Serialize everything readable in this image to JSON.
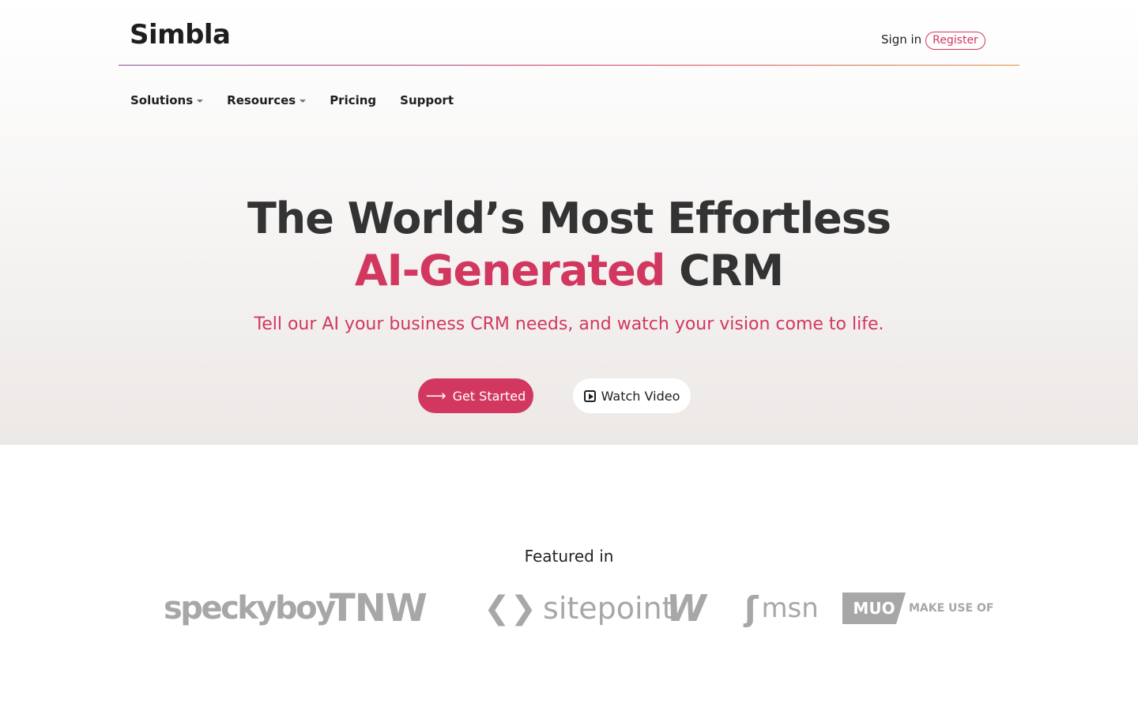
{
  "header": {
    "logo": "Simbla",
    "sign_in": "Sign in",
    "register": "Register"
  },
  "nav": {
    "items": [
      {
        "label": "Solutions",
        "has_dropdown": true
      },
      {
        "label": "Resources",
        "has_dropdown": true
      },
      {
        "label": "Pricing",
        "has_dropdown": false
      },
      {
        "label": "Support",
        "has_dropdown": false
      }
    ]
  },
  "hero": {
    "title_line1": "The World’s Most Effortless",
    "title_accent": "AI-Generated",
    "title_line2_rest": "CRM",
    "subtitle": "Tell our AI your business CRM needs, and watch your vision come to life.",
    "cta_primary": "Get Started",
    "cta_secondary": "Watch Video"
  },
  "featured": {
    "title": "Featured in",
    "logos": [
      "speckyboy",
      "TNW",
      "sitepoint",
      "W",
      "msn",
      "MUO",
      "MAKE USE OF"
    ]
  },
  "colors": {
    "accent": "#d2385f",
    "text": "#333333",
    "logo_gray": "#a7a7a7"
  }
}
